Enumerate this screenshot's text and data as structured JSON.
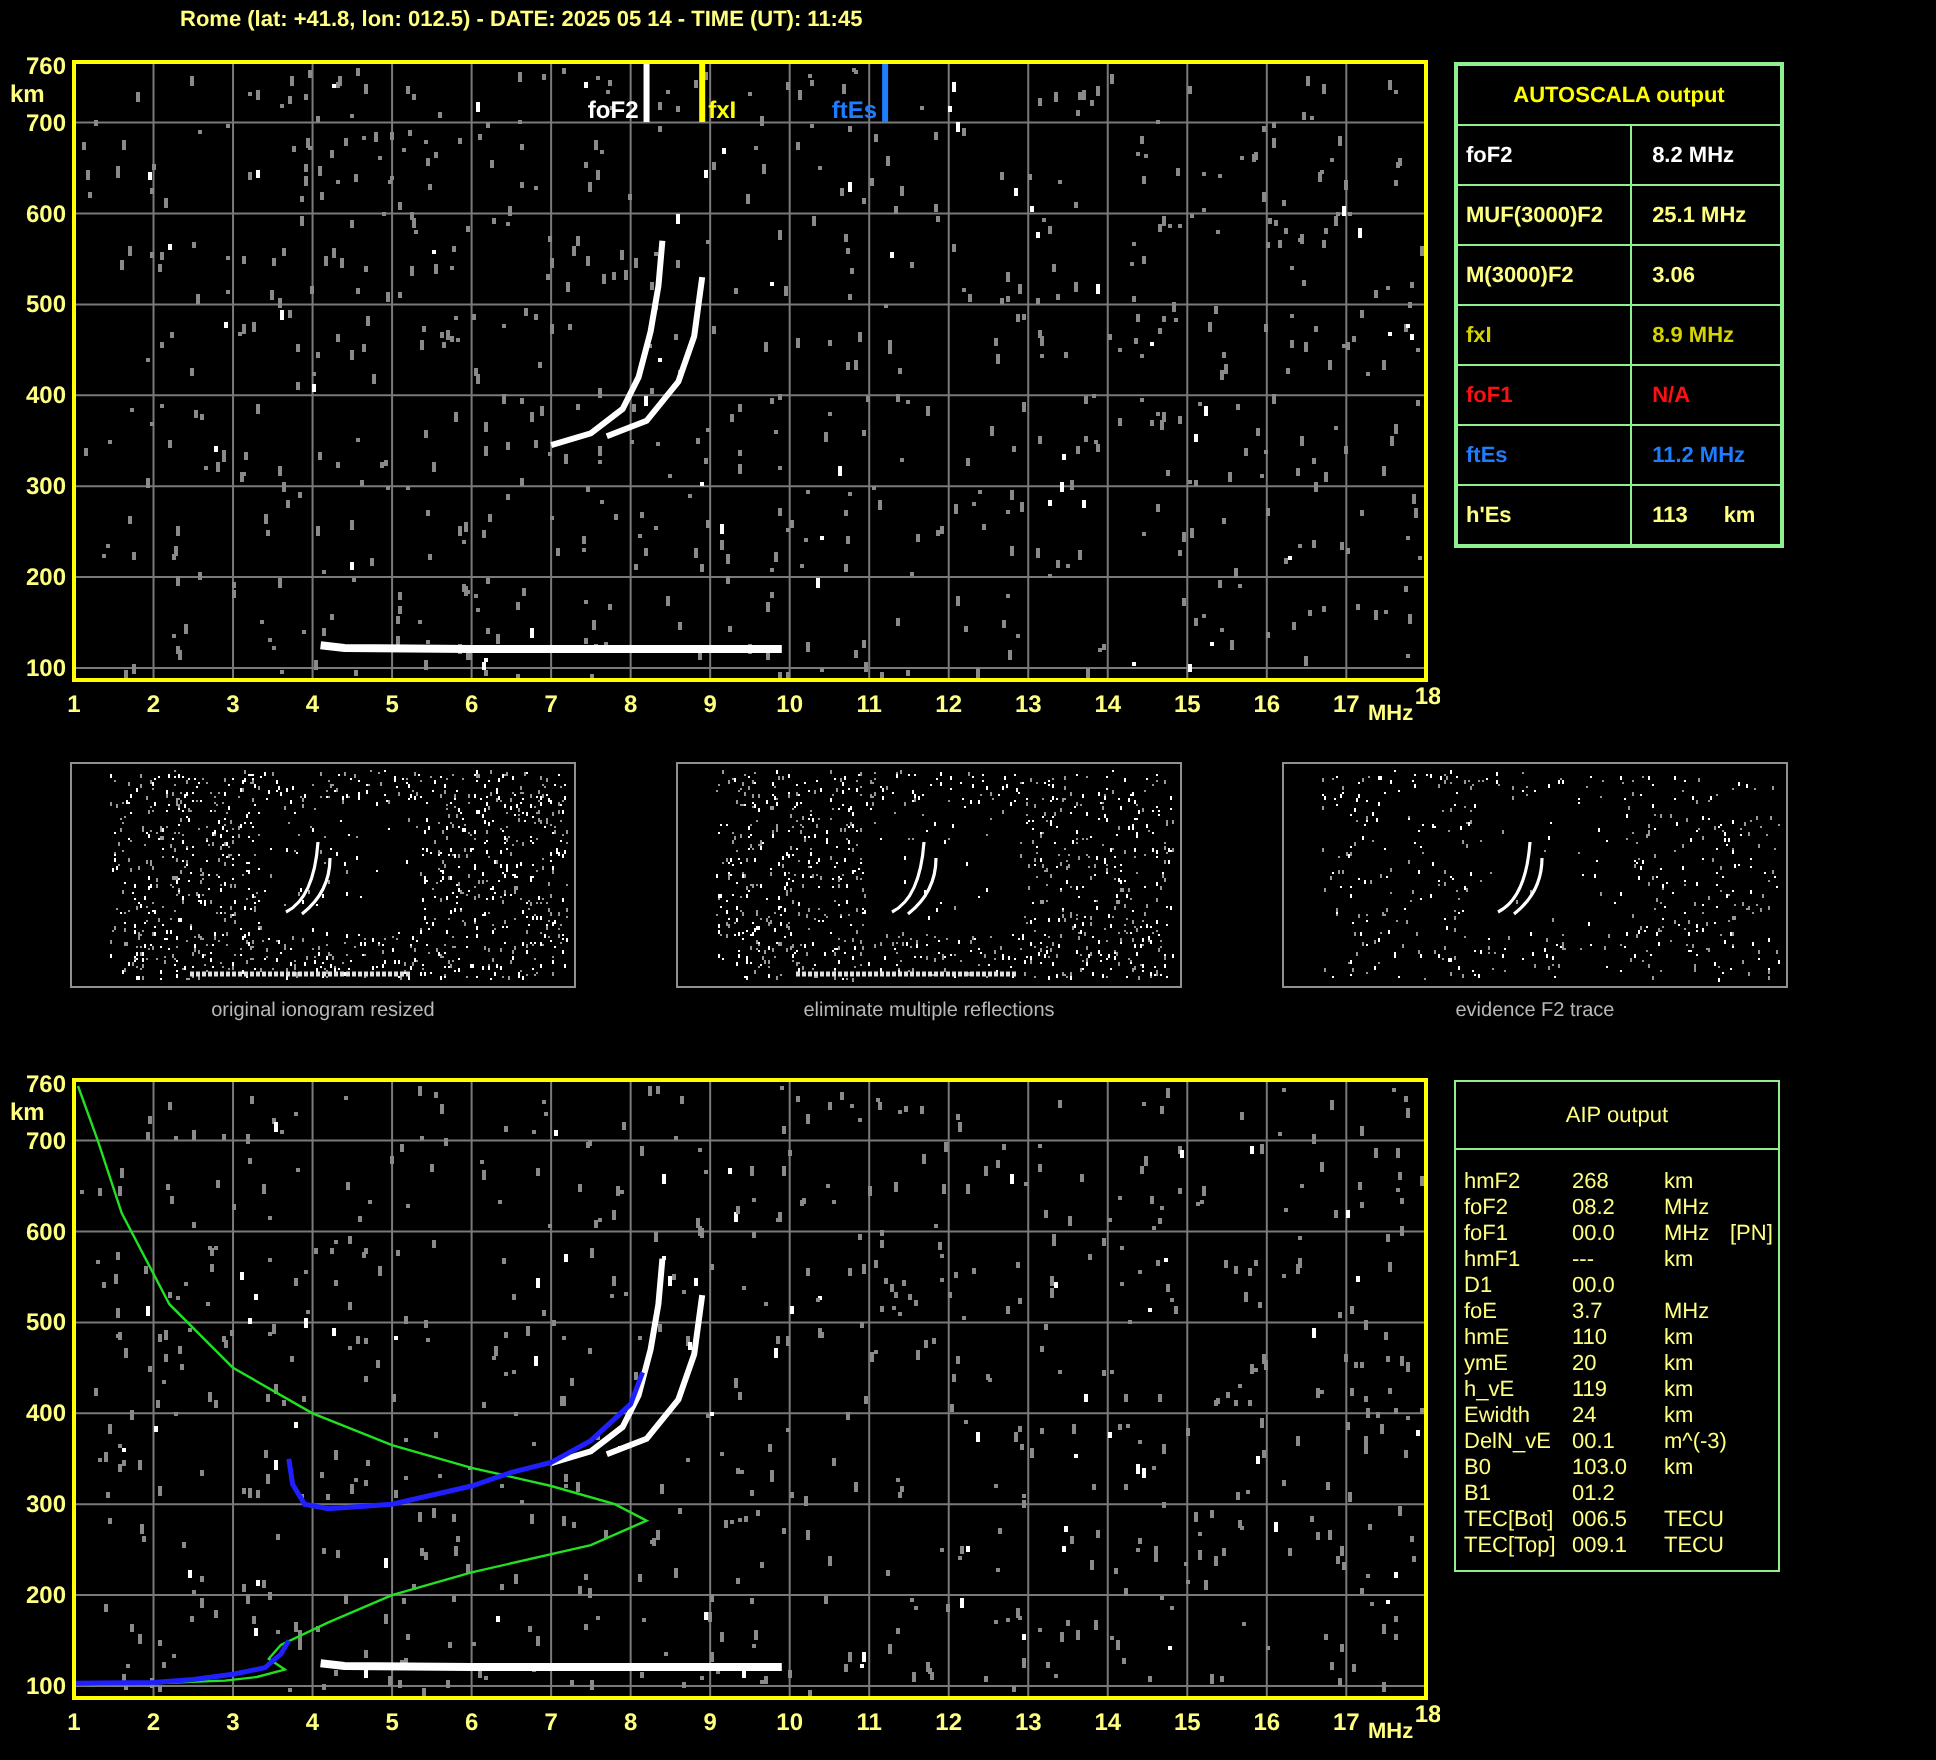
{
  "header": {
    "title": "Rome (lat: +41.8, lon: 012.5) - DATE: 2025 05 14 - TIME (UT): 11:45"
  },
  "ionogram": {
    "y_unit": "km",
    "y_ticks": [
      "760",
      "700",
      "600",
      "500",
      "400",
      "300",
      "200",
      "100"
    ],
    "x_unit": "MHz",
    "x_ticks": [
      "1",
      "2",
      "3",
      "4",
      "5",
      "6",
      "7",
      "8",
      "9",
      "10",
      "11",
      "12",
      "13",
      "14",
      "15",
      "16",
      "17",
      "18"
    ],
    "markers": [
      {
        "label": "foF2",
        "color": "#ffffff"
      },
      {
        "label": "fxI",
        "color": "#ffff00"
      },
      {
        "label": "ftEs",
        "color": "#1e7cff"
      }
    ]
  },
  "autoscala": {
    "title": "AUTOSCALA output",
    "rows": [
      {
        "name": "foF2",
        "value": "8.2 MHz",
        "color": "#ffffff"
      },
      {
        "name": "MUF(3000)F2",
        "value": "25.1 MHz",
        "color": "#ffff80"
      },
      {
        "name": "M(3000)F2",
        "value": "3.06",
        "color": "#ffff80"
      },
      {
        "name": "fxI",
        "value": "8.9 MHz",
        "color": "#d4d400"
      },
      {
        "name": "foF1",
        "value": "N/A",
        "color": "#ff1010"
      },
      {
        "name": "ftEs",
        "value": "11.2 MHz",
        "color": "#1e7cff"
      },
      {
        "name": "h'Es",
        "value": "113",
        "unit": "km",
        "color": "#ffff80"
      }
    ]
  },
  "thumbnails": [
    {
      "caption": "original ionogram resized",
      "kind": "original"
    },
    {
      "caption": "eliminate multiple reflections",
      "kind": "filtered"
    },
    {
      "caption": "evidence F2 trace",
      "kind": "f2"
    }
  ],
  "profile_plot": {
    "y_unit": "km",
    "y_ticks": [
      "760",
      "700",
      "600",
      "500",
      "400",
      "300",
      "200",
      "100"
    ],
    "x_unit": "MHz",
    "x_ticks": [
      "1",
      "2",
      "3",
      "4",
      "5",
      "6",
      "7",
      "8",
      "9",
      "10",
      "11",
      "12",
      "13",
      "14",
      "15",
      "16",
      "17",
      "18"
    ]
  },
  "aip": {
    "title": "AIP output",
    "rows": [
      {
        "param": "hmF2",
        "value": "268",
        "unit": "km"
      },
      {
        "param": "foF2",
        "value": "08.2",
        "unit": "MHz"
      },
      {
        "param": "foF1",
        "value": "00.0",
        "unit": "MHz",
        "note": "[PN]"
      },
      {
        "param": "hmF1",
        "value": "---",
        "unit": "km"
      },
      {
        "param": "D1",
        "value": "00.0"
      },
      {
        "param": "foE",
        "value": "3.7",
        "unit": "MHz"
      },
      {
        "param": "hmE",
        "value": "110",
        "unit": "km"
      },
      {
        "param": "ymE",
        "value": "20",
        "unit": "km"
      },
      {
        "param": "h_vE",
        "value": "119",
        "unit": "km"
      },
      {
        "param": "Ewidth",
        "value": "24",
        "unit": "km"
      },
      {
        "param": "DelN_vE",
        "value": "00.1",
        "unit": "m^(-3)"
      },
      {
        "param": "B0",
        "value": "103.0",
        "unit": "km"
      },
      {
        "param": "B1",
        "value": "01.2"
      },
      {
        "param": "TEC[Bot]",
        "value": "006.5",
        "unit": "TECU"
      },
      {
        "param": "TEC[Top]",
        "value": "009.1",
        "unit": "TECU"
      }
    ]
  }
}
